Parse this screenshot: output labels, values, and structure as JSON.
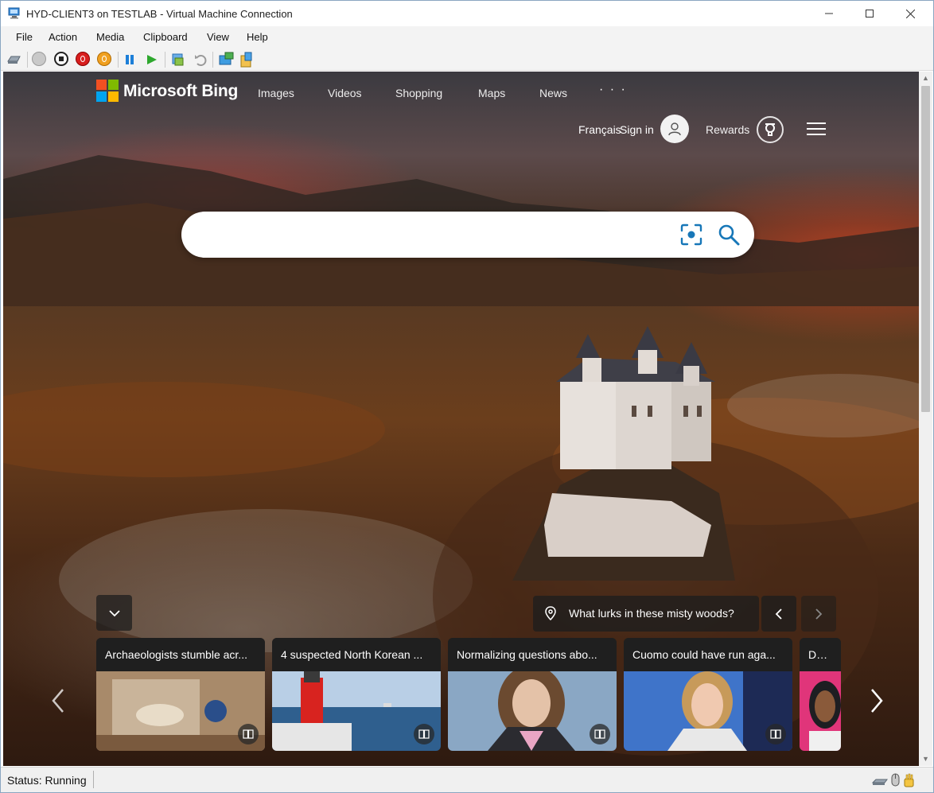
{
  "window": {
    "title": "HYD-CLIENT3 on TESTLAB - Virtual Machine Connection",
    "minimize": "—",
    "maximize": "☐",
    "close": "✕"
  },
  "menu": {
    "items": [
      {
        "label": "File"
      },
      {
        "label": "Action"
      },
      {
        "label": "Media"
      },
      {
        "label": "Clipboard"
      },
      {
        "label": "View"
      },
      {
        "label": "Help"
      }
    ]
  },
  "toolbar": {
    "icons": [
      "ctrl-alt-del-icon",
      "start-icon",
      "turn-off-icon",
      "shut-down-icon",
      "power-icon",
      "pause-icon",
      "resume-icon",
      "checkpoint-icon",
      "revert-icon",
      "enhanced-session-icon",
      "share-icon"
    ]
  },
  "bing": {
    "brand": "Microsoft Bing",
    "logo_colors": [
      "#f25022",
      "#7fba00",
      "#00a4ef",
      "#ffb900"
    ],
    "nav": [
      {
        "label": "Images"
      },
      {
        "label": "Videos"
      },
      {
        "label": "Shopping"
      },
      {
        "label": "Maps"
      },
      {
        "label": "News"
      }
    ],
    "nav_more": "· · ·",
    "language": "Français",
    "sign_in": "Sign in",
    "rewards": "Rewards",
    "search": {
      "value": "",
      "placeholder": ""
    },
    "accent": "#174ae4",
    "caption": "What lurks in these misty woods?",
    "cards": [
      {
        "title": "Archaeologists stumble acr..."
      },
      {
        "title": "4 suspected North Korean ..."
      },
      {
        "title": "Normalizing questions abo..."
      },
      {
        "title": "Cuomo could have run aga..."
      },
      {
        "title": "Do tip"
      }
    ]
  },
  "status": {
    "text": "Status: Running"
  }
}
